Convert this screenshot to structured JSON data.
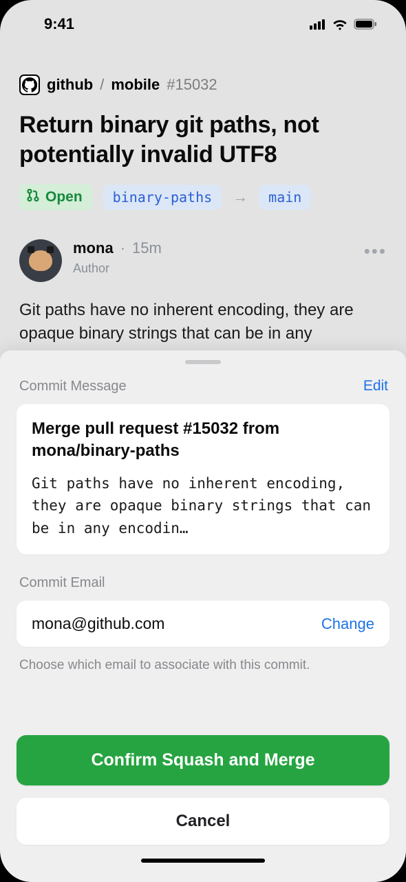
{
  "statusbar": {
    "time": "9:41"
  },
  "breadcrumb": {
    "owner": "github",
    "repo": "mobile",
    "number": "#15032"
  },
  "pr": {
    "title": "Return binary git paths, not potentially invalid UTF8",
    "state_label": "Open",
    "head_ref": "binary-paths",
    "base_ref": "main"
  },
  "comment": {
    "author": "mona",
    "timestamp": "15m",
    "role_badge": "Author",
    "body": "Git paths have no inherent encoding, they are opaque binary strings that can be in any"
  },
  "sheet": {
    "commit_section_label": "Commit Message",
    "edit_label": "Edit",
    "commit_title": "Merge pull request #15032 from mona/binary-paths",
    "commit_body": "Git paths have no inherent encoding, they are opaque binary strings that can be in any encodin…",
    "email_section_label": "Commit Email",
    "email_value": "mona@github.com",
    "email_change_label": "Change",
    "email_helper": "Choose which email to associate with this commit.",
    "confirm_label": "Confirm Squash and Merge",
    "cancel_label": "Cancel"
  }
}
